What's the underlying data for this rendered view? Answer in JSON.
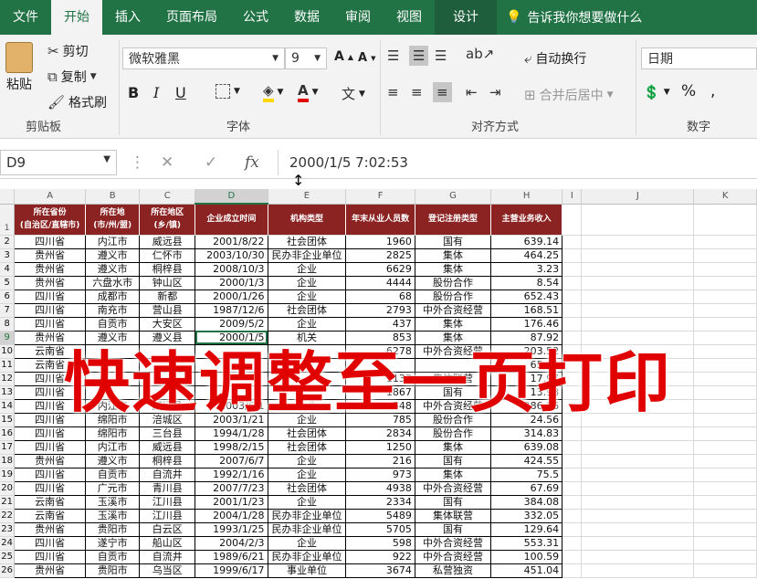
{
  "tabs": [
    "文件",
    "开始",
    "插入",
    "页面布局",
    "公式",
    "数据",
    "审阅",
    "视图",
    "设计"
  ],
  "tellme": "告诉我你想要做什么",
  "clipboard": {
    "paste": "粘贴",
    "cut": "剪切",
    "copy": "复制",
    "format_painter": "格式刷",
    "label": "剪贴板"
  },
  "font": {
    "name": "微软雅黑",
    "size": "9",
    "label": "字体",
    "bold": "B",
    "italic": "I",
    "underline": "U"
  },
  "alignment": {
    "wrap": "自动换行",
    "merge": "合并后居中",
    "label": "对齐方式"
  },
  "number": {
    "format": "日期",
    "label": "数字",
    "percent": "%"
  },
  "formula_bar": {
    "cell": "D9",
    "value": "2000/1/5  7:02:53",
    "fx": "fx"
  },
  "columns": [
    "A",
    "B",
    "C",
    "D",
    "E",
    "F",
    "G",
    "H",
    "I",
    "J",
    "K"
  ],
  "headers": [
    "所在省份\n(自治区/直辖市)",
    "所在地\n(市/州/盟)",
    "所在地区\n(乡/镇)",
    "企业成立时间",
    "机构类型",
    "年末从业人员数",
    "登记注册类型",
    "主营业务收入"
  ],
  "rows": [
    [
      "四川省",
      "内江市",
      "威远县",
      "2001/8/22",
      "社会团体",
      "1960",
      "国有",
      "639.14"
    ],
    [
      "贵州省",
      "遵义市",
      "仁怀市",
      "2003/10/30",
      "民办非企业单位",
      "2825",
      "集体",
      "464.25"
    ],
    [
      "贵州省",
      "遵义市",
      "桐梓县",
      "2008/10/3",
      "企业",
      "6629",
      "集体",
      "3.23"
    ],
    [
      "贵州省",
      "六盘水市",
      "钟山区",
      "2000/1/3",
      "企业",
      "4444",
      "股份合作",
      "8.54"
    ],
    [
      "四川省",
      "成都市",
      "新都",
      "2000/1/26",
      "企业",
      "68",
      "股份合作",
      "652.43"
    ],
    [
      "四川省",
      "南充市",
      "营山县",
      "1987/12/6",
      "社会团体",
      "2793",
      "中外合资经营",
      "168.51"
    ],
    [
      "四川省",
      "自贡市",
      "大安区",
      "2009/5/2",
      "企业",
      "437",
      "集体",
      "176.46"
    ],
    [
      "贵州省",
      "遵义市",
      "遵义县",
      "2000/1/5",
      "机关",
      "853",
      "集体",
      "87.92"
    ],
    [
      "云南省",
      "",
      "",
      "",
      "",
      "6278",
      "中外合资经营",
      "203.52"
    ],
    [
      "云南省",
      "",
      "",
      "",
      "",
      "",
      "",
      "65.65"
    ],
    [
      "四川省",
      "",
      "",
      "",
      "",
      "1133",
      "集体联营",
      "17.97"
    ],
    [
      "四川省",
      "",
      "",
      "",
      "",
      "1867",
      "国有",
      "13.98"
    ],
    [
      "四川省",
      "内江市",
      "威远县",
      "2003/6/1",
      "企业",
      "548",
      "中外合资经营",
      "286.56"
    ],
    [
      "四川省",
      "绵阳市",
      "涪城区",
      "2003/1/21",
      "企业",
      "785",
      "股份合作",
      "24.56"
    ],
    [
      "四川省",
      "绵阳市",
      "三台县",
      "1994/1/28",
      "社会团体",
      "2834",
      "股份合作",
      "314.83"
    ],
    [
      "四川省",
      "内江市",
      "威远县",
      "1998/2/15",
      "社会团体",
      "1250",
      "集体",
      "639.08"
    ],
    [
      "贵州省",
      "遵义市",
      "桐梓县",
      "2007/6/7",
      "企业",
      "216",
      "国有",
      "424.55"
    ],
    [
      "四川省",
      "自贡市",
      "自流井",
      "1992/1/16",
      "企业",
      "973",
      "集体",
      "75.5"
    ],
    [
      "四川省",
      "广元市",
      "青川县",
      "2007/7/23",
      "社会团体",
      "4938",
      "中外合资经营",
      "67.69"
    ],
    [
      "云南省",
      "玉溪市",
      "江川县",
      "2001/1/23",
      "企业",
      "2334",
      "国有",
      "384.08"
    ],
    [
      "云南省",
      "玉溪市",
      "江川县",
      "2004/1/28",
      "民办非企业单位",
      "5489",
      "集体联营",
      "332.05"
    ],
    [
      "贵州省",
      "贵阳市",
      "白云区",
      "1993/1/25",
      "民办非企业单位",
      "5705",
      "国有",
      "129.64"
    ],
    [
      "四川省",
      "遂宁市",
      "船山区",
      "2004/2/3",
      "企业",
      "598",
      "中外合资经营",
      "553.31"
    ],
    [
      "四川省",
      "自贡市",
      "自流井",
      "1989/6/21",
      "民办非企业单位",
      "922",
      "中外合资经营",
      "100.59"
    ],
    [
      "贵州省",
      "贵阳市",
      "乌当区",
      "1999/6/17",
      "事业单位",
      "3674",
      "私营独资",
      "451.04"
    ]
  ],
  "overlay_text": "快速调整至一页打印"
}
